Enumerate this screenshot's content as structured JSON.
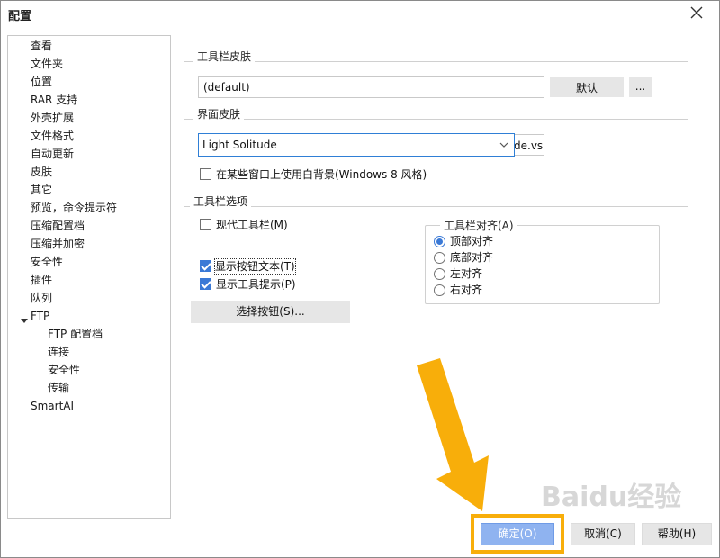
{
  "window": {
    "title": "配置"
  },
  "tree": {
    "items": [
      {
        "label": "查看"
      },
      {
        "label": "文件夹"
      },
      {
        "label": "位置"
      },
      {
        "label": "RAR 支持"
      },
      {
        "label": "外壳扩展"
      },
      {
        "label": "文件格式"
      },
      {
        "label": "自动更新"
      },
      {
        "label": "皮肤"
      },
      {
        "label": "其它"
      },
      {
        "label": "预览，命令提示符"
      },
      {
        "label": "压缩配置档"
      },
      {
        "label": "压缩并加密"
      },
      {
        "label": "安全性"
      },
      {
        "label": "插件"
      },
      {
        "label": "队列"
      },
      {
        "label": "FTP"
      },
      {
        "label": "FTP 配置档"
      },
      {
        "label": "连接"
      },
      {
        "label": "安全性"
      },
      {
        "label": "传输"
      },
      {
        "label": "SmartAI"
      }
    ]
  },
  "toolbar_skin": {
    "group_label": "工具栏皮肤",
    "value": "(default)",
    "default_button": "默认",
    "browse_button": "..."
  },
  "ui_skin": {
    "group_label": "界面皮肤",
    "selected": "Light Solitude",
    "tail_text": "de.vsl",
    "white_bg_checkbox": "在某些窗口上使用白背景(Windows 8 风格)",
    "white_bg_checked": false
  },
  "toolbar_options": {
    "group_label": "工具栏选项",
    "modern_toolbar": "现代工具栏(M)",
    "modern_toolbar_checked": false,
    "show_button_text": "显示按钮文本(T)",
    "show_button_text_checked": true,
    "show_tooltips": "显示工具提示(P)",
    "show_tooltips_checked": true,
    "choose_buttons": "选择按钮(S)..."
  },
  "toolbar_align": {
    "group_label": "工具栏对齐(A)",
    "options": [
      {
        "label": "顶部对齐",
        "selected": true
      },
      {
        "label": "底部对齐",
        "selected": false
      },
      {
        "label": "左对齐",
        "selected": false
      },
      {
        "label": "右对齐",
        "selected": false
      }
    ]
  },
  "footer": {
    "ok": "确定(O)",
    "cancel": "取消(C)",
    "help": "帮助(H)"
  },
  "watermark": {
    "text": "Baidu经验"
  },
  "colors": {
    "accent": "#3a79d6",
    "highlight": "#f8ae0a",
    "ok_button": "#8fb3f0"
  }
}
